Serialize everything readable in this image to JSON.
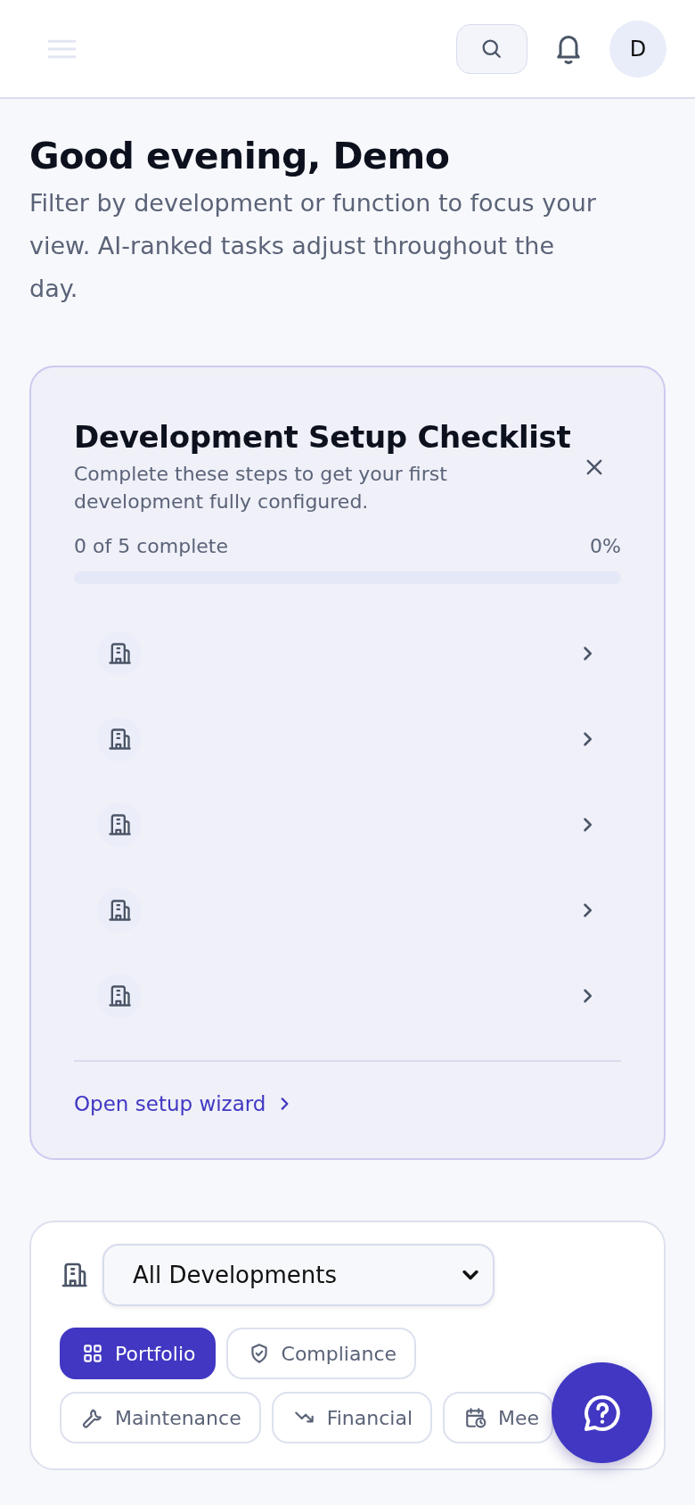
{
  "header": {
    "avatar": "D"
  },
  "greeting": {
    "title": "Good evening, Demo",
    "subtitle": "Filter by development or function to focus your view. AI-ranked tasks adjust throughout the day."
  },
  "checklist": {
    "title": "Development Setup Checklist",
    "subtitle": "Complete these steps to get your first development fully configured.",
    "progress_text": "0 of 5 complete",
    "percent": "0%",
    "level": 0,
    "steps": [
      {
        "completed": false
      },
      {
        "completed": false
      },
      {
        "completed": false
      },
      {
        "completed": false
      },
      {
        "completed": false
      }
    ],
    "link": "Open setup wizard"
  },
  "filters": {
    "development": "All Developments",
    "chip_rows": [
      [
        {
          "label": "Portfolio",
          "kind": "grid",
          "selected": true
        },
        {
          "label": "Compliance",
          "kind": "shield",
          "selected": false
        }
      ],
      [
        {
          "label": "Maintenance",
          "kind": "wrench",
          "selected": false
        },
        {
          "label": "Financial",
          "kind": "trend",
          "selected": false
        },
        {
          "label": "Mee",
          "kind": "calendar",
          "selected": false
        }
      ]
    ]
  }
}
